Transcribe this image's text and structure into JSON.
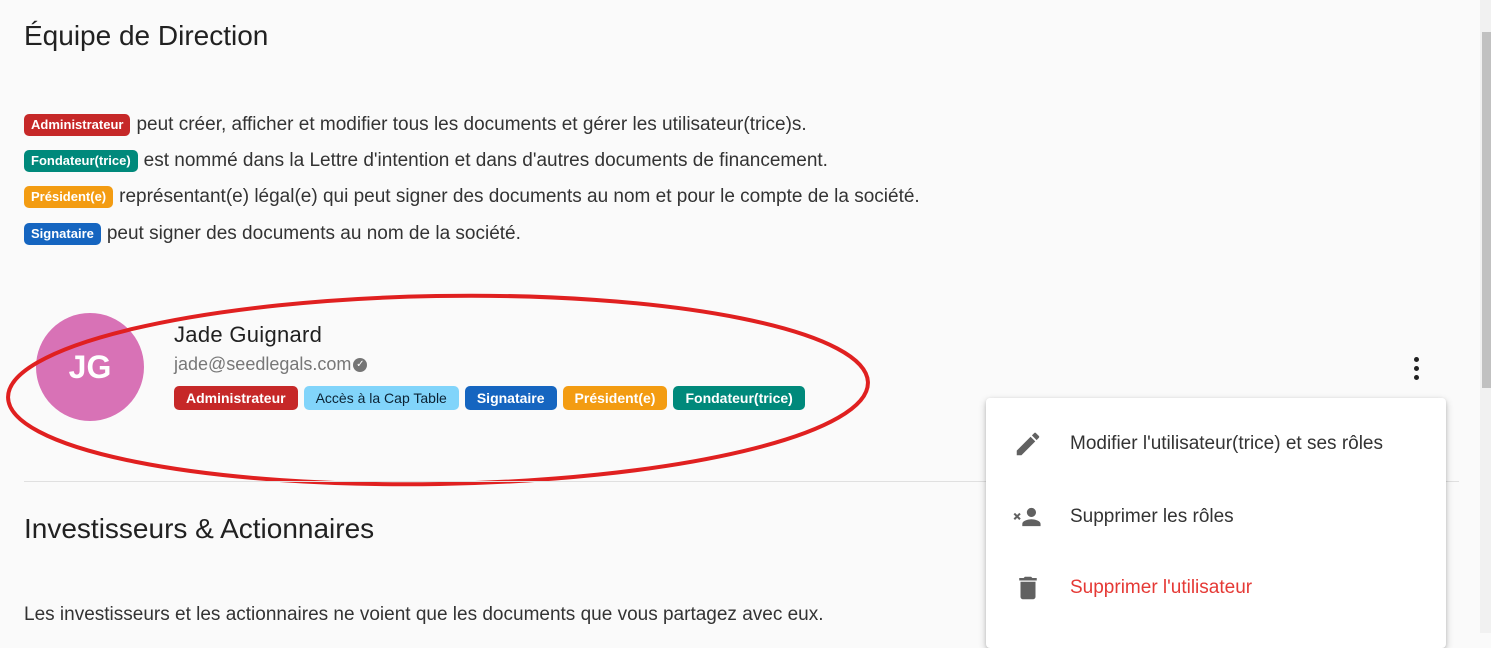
{
  "section1": {
    "title": "Équipe de Direction",
    "roles": [
      {
        "chip": "Administrateur",
        "color": "#c62828",
        "text": "peut créer, afficher et modifier tous les documents et gérer les utilisateur(trice)s."
      },
      {
        "chip": "Fondateur(trice)",
        "color": "#00897b",
        "text": "est nommé dans la Lettre d'intention et dans d'autres documents de financement."
      },
      {
        "chip": "Président(e)",
        "color": "#f39c12",
        "text": "représentant(e) légal(e) qui peut signer des documents au nom et pour le compte de la société."
      },
      {
        "chip": "Signataire",
        "color": "#1565c0",
        "text": "peut signer des documents au nom de la société."
      }
    ]
  },
  "user": {
    "initials": "JG",
    "name": "Jade Guignard",
    "email": "jade@seedlegals.com",
    "avatar_color": "#d872b6",
    "chips": [
      "Administrateur",
      "Accès à la Cap Table",
      "Signataire",
      "Président(e)",
      "Fondateur(trice)"
    ]
  },
  "section2": {
    "title": "Investisseurs & Actionnaires",
    "description": "Les investisseurs et les actionnaires ne voient que les documents que vous partagez avec eux."
  },
  "menu": {
    "items": [
      {
        "label": "Modifier l'utilisateur(trice) et ses rôles",
        "icon": "pencil-icon"
      },
      {
        "label": "Supprimer les rôles",
        "icon": "remove-person-icon"
      },
      {
        "label": "Supprimer l'utilisateur",
        "icon": "trash-icon",
        "danger": true
      }
    ]
  },
  "annotation": {
    "color": "#e02020",
    "shape": "ellipse"
  }
}
